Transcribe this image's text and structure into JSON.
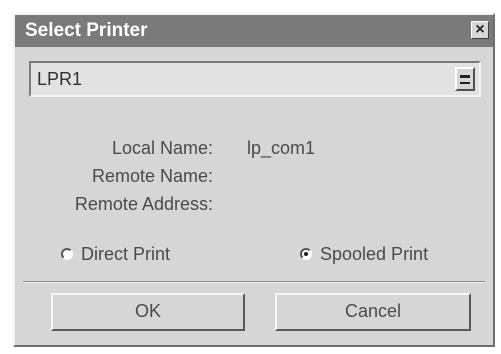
{
  "window": {
    "title": "Select Printer",
    "close_glyph": "×"
  },
  "printer_select": {
    "value": "LPR1",
    "arrow_icon": "dropdown-arrow-icon"
  },
  "details": {
    "local_name_label": "Local Name:",
    "local_name_value": "lp_com1",
    "remote_name_label": "Remote Name:",
    "remote_name_value": "",
    "remote_address_label": "Remote Address:",
    "remote_address_value": ""
  },
  "print_mode": {
    "options": [
      {
        "label": "Direct Print",
        "selected": false
      },
      {
        "label": "Spooled Print",
        "selected": true
      }
    ]
  },
  "buttons": {
    "ok": "OK",
    "cancel": "Cancel"
  }
}
